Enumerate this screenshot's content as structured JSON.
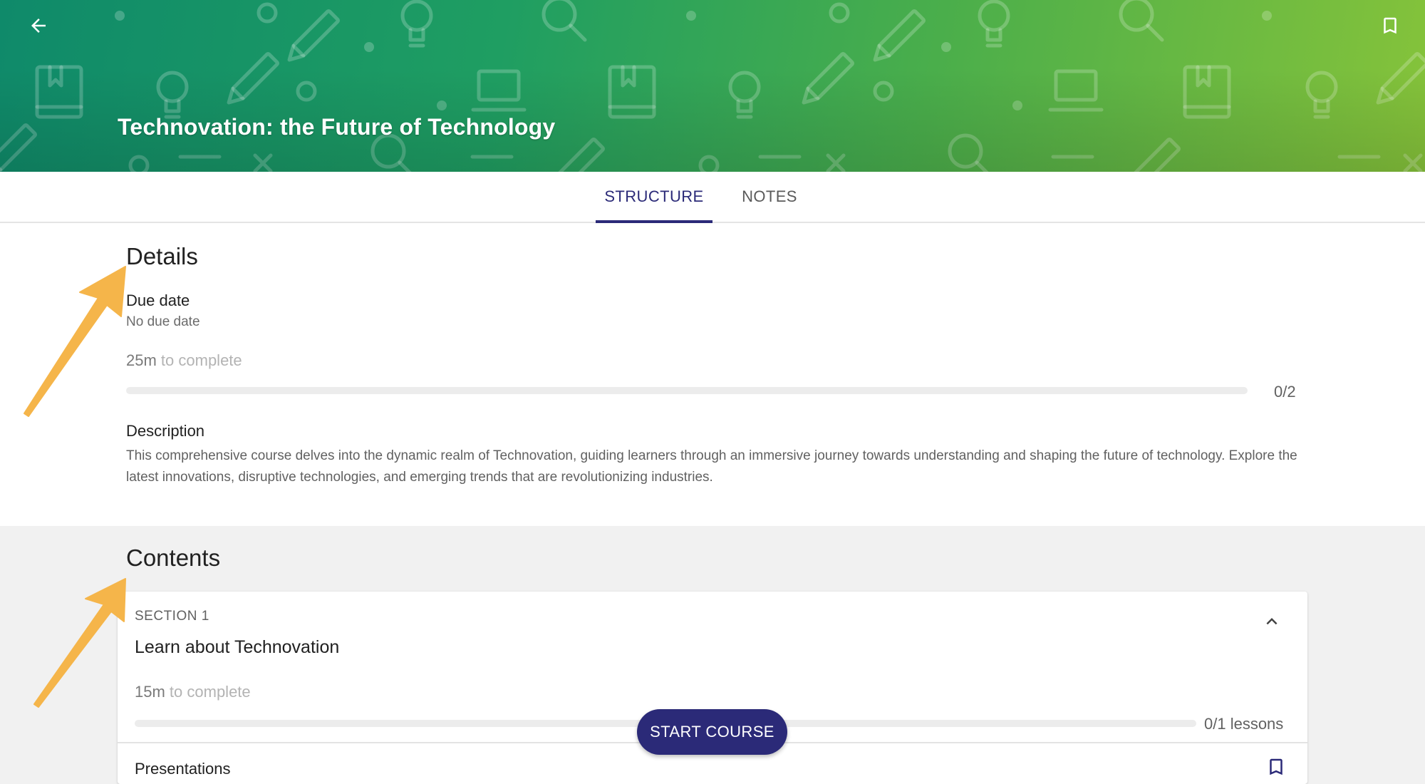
{
  "header": {
    "title": "Technovation: the Future of Technology",
    "back_icon": "arrow-back-icon",
    "bookmark_icon": "bookmark-outline-icon",
    "gradient_colors": [
      "#0f8a6a",
      "#86c33a"
    ]
  },
  "tabs": [
    {
      "label": "STRUCTURE",
      "active": true
    },
    {
      "label": "NOTES",
      "active": false
    }
  ],
  "details": {
    "heading": "Details",
    "due_date_label": "Due date",
    "due_date_value": "No due date",
    "time_value": "25m",
    "time_suffix": "to complete",
    "progress_completed": 0,
    "progress_total": 2,
    "progress_text": "0/2",
    "description_label": "Description",
    "description_text": "This comprehensive course delves into the dynamic realm of Technovation, guiding learners through an immersive journey towards understanding and shaping the future of technology. Explore the latest innovations, disruptive technologies, and emerging trends that are revolutionizing industries."
  },
  "contents": {
    "heading": "Contents",
    "sections": [
      {
        "overline": "SECTION 1",
        "title": "Learn about Technovation",
        "time_value": "15m",
        "time_suffix": "to complete",
        "progress_completed": 0,
        "progress_total": 1,
        "progress_text": "0/1 lessons",
        "collapse_icon": "chevron-up-icon",
        "lessons": [
          {
            "title": "Presentations",
            "icon": "bookmark-outline-icon"
          }
        ]
      }
    ]
  },
  "start_button": {
    "label": "START COURSE"
  },
  "colors": {
    "accent": "#2b2a78",
    "annotation_arrow": "#f5b54a"
  }
}
